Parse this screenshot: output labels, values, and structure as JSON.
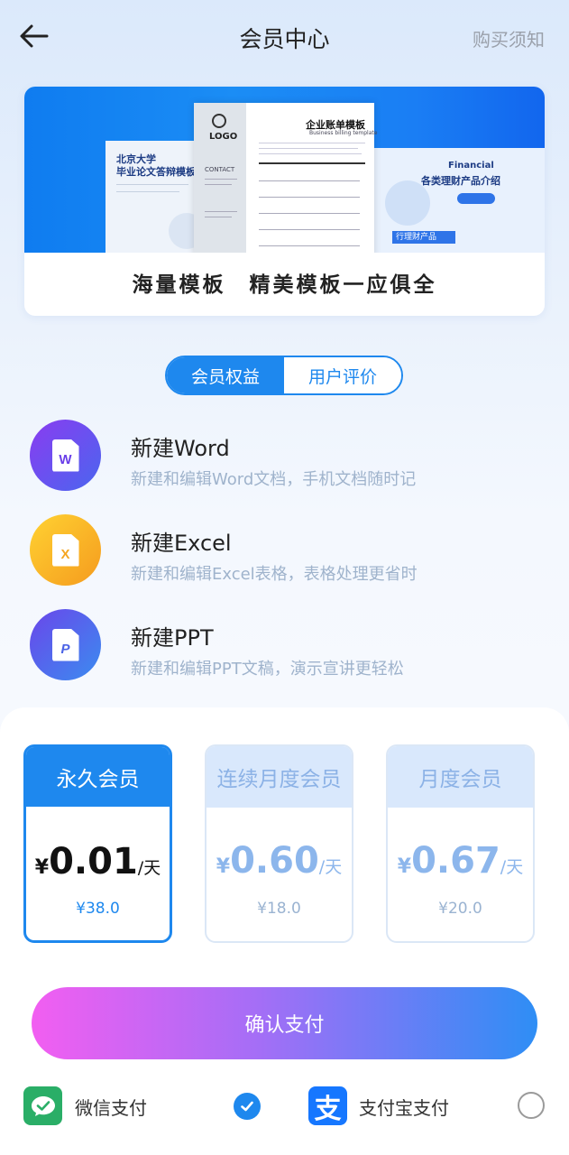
{
  "header": {
    "title": "会员中心",
    "right_link": "购买须知",
    "back_icon": "back-arrow-icon"
  },
  "banner": {
    "caption": "海量模板　精美模板一应俱全",
    "thumbnails": {
      "left_title_1": "北京大学",
      "left_title_2": "毕业论文答辩模板",
      "mid_logo": "LOGO",
      "mid_contact": "CONTACT",
      "mid_title": "企业账单模板",
      "mid_subtitle": "Business billing template",
      "right_en": "Financial",
      "right_title": "各类理财产品介绍",
      "right_tag": "行理财产品"
    }
  },
  "tabs": [
    {
      "label": "会员权益",
      "active": true
    },
    {
      "label": "用户评价",
      "active": false
    }
  ],
  "features": [
    {
      "title": "新建Word",
      "desc": "新建和编辑Word文档，手机文档随时记",
      "icon": "word-doc-icon",
      "glyph": "W",
      "color": "#6a3fe8"
    },
    {
      "title": "新建Excel",
      "desc": "新建和编辑Excel表格，表格处理更省时",
      "icon": "excel-doc-icon",
      "glyph": "X",
      "color": "#f5a623"
    },
    {
      "title": "新建PPT",
      "desc": "新建和编辑PPT文稿，演示宣讲更轻松",
      "icon": "ppt-doc-icon",
      "glyph": "P",
      "color": "#4b63e6"
    }
  ],
  "plans": [
    {
      "name": "永久会员",
      "currency": "¥",
      "price": "0.01",
      "unit": "/天",
      "total": "¥38.0",
      "selected": true
    },
    {
      "name": "连续月度会员",
      "currency": "¥",
      "price": "0.60",
      "unit": "/天",
      "total": "¥18.0",
      "selected": false
    },
    {
      "name": "月度会员",
      "currency": "¥",
      "price": "0.67",
      "unit": "/天",
      "total": "¥20.0",
      "selected": false
    }
  ],
  "confirm_label": "确认支付",
  "payment_methods": [
    {
      "label": "微信支付",
      "icon": "wechat-pay-icon",
      "selected": true,
      "color": "#2aae67"
    },
    {
      "label": "支付宝支付",
      "icon": "alipay-icon",
      "glyph": "支",
      "selected": false,
      "color": "#1677ff"
    }
  ]
}
